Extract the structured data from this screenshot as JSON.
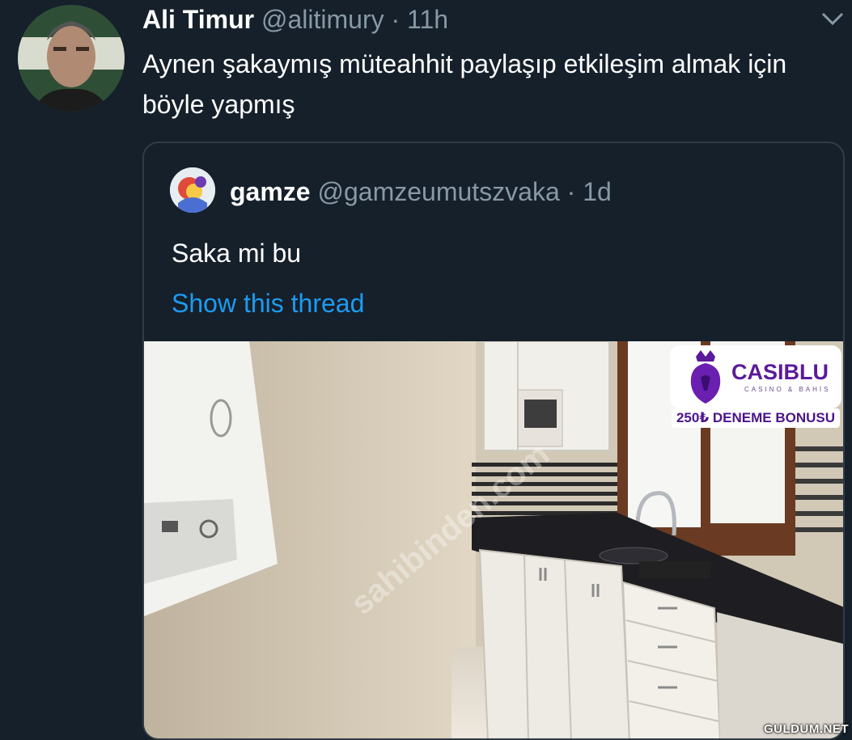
{
  "tweet": {
    "author_name": "Ali Timur",
    "author_handle": "@alitimury · 11h",
    "text": "Aynen şakaymış müteahhit paylaşıp etkileşim almak için böyle yapmış"
  },
  "quoted_tweet": {
    "author_name": "gamze",
    "author_handle": "@gamzeumutszvaka · 1d",
    "text": "Saka mi bu",
    "thread_link": "Show this thread",
    "image_watermark": "sahibinden.com"
  },
  "ad_banner": {
    "brand": "CASIBLU",
    "tagline": "CASINO & BAHİS",
    "offer": "250₺ DENEME BONUSU"
  },
  "site_credit": "GULDUM.NET",
  "icons": [
    "avatar",
    "chevron-down-icon",
    "lion-crown-icon"
  ],
  "colors": {
    "background": "#15202b",
    "link": "#1d9bf0",
    "secondary_text": "#8899a6",
    "ad_purple": "#5b1a9a"
  }
}
